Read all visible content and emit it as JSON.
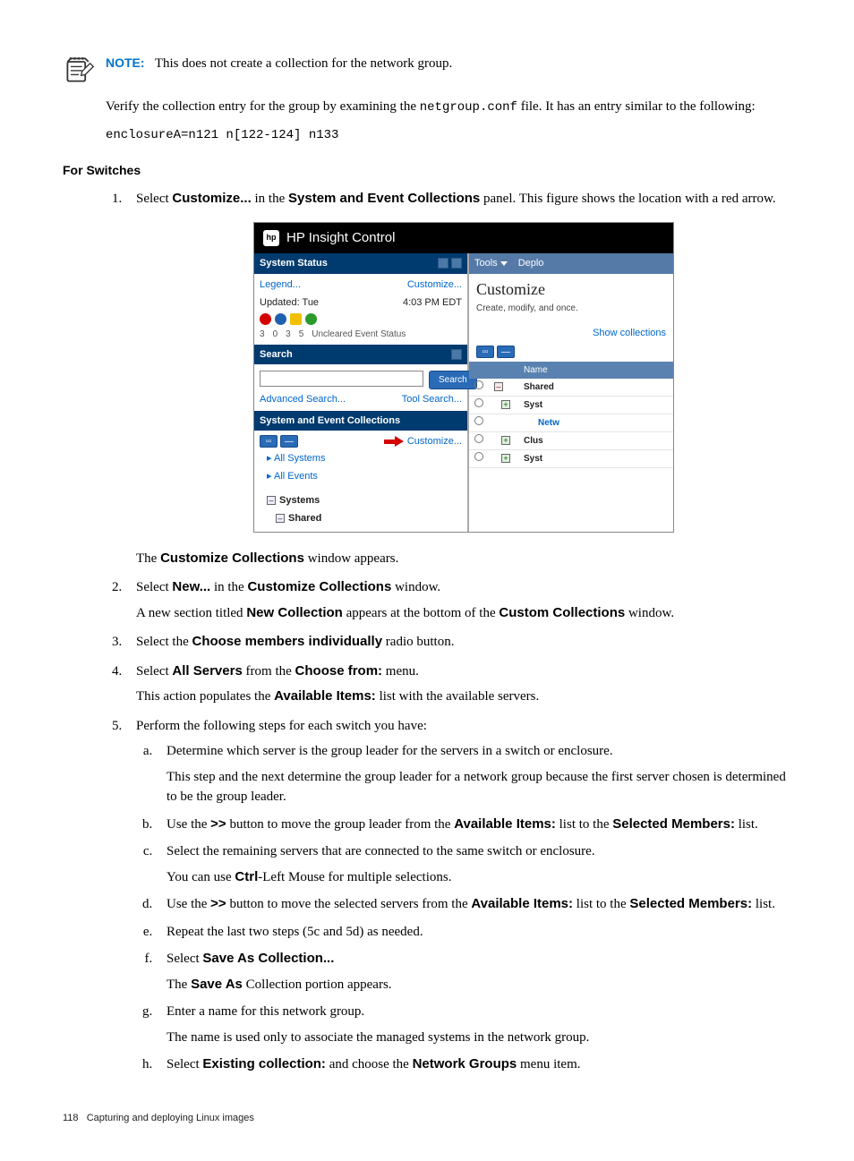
{
  "note": {
    "label": "NOTE:",
    "text": "This does not create a collection for the network group."
  },
  "verify_text_pre": "Verify the collection entry for the group by examining the ",
  "verify_file": "netgroup.conf",
  "verify_text_post": " file. It has an entry similar to the following:",
  "code_line": "enclosureA=n121 n[122-124] n133",
  "for_switches": "For Switches",
  "step1": {
    "pre": "Select ",
    "b1": "Customize...",
    "mid": " in the ",
    "b2": "System and Event Collections",
    "post": " panel. This figure shows the location with a red arrow."
  },
  "screenshot": {
    "title": "HP Insight Control",
    "left": {
      "sys_status": "System Status",
      "legend": "Legend...",
      "customize": "Customize...",
      "updated": "Updated: Tue",
      "time": "4:03 PM EDT",
      "uncleared": "Uncleared Event Status",
      "counts": [
        "3",
        "0",
        "3",
        "5"
      ],
      "search_hdr": "Search",
      "search_btn": "Search",
      "adv_search": "Advanced Search...",
      "tool_search": "Tool Search...",
      "sec_hdr": "System and Event Collections",
      "customize2": "Customize...",
      "all_systems": "All Systems",
      "all_events": "All Events",
      "systems": "Systems",
      "shared": "Shared"
    },
    "right": {
      "tools": "Tools",
      "deploy": "Deplo",
      "customize_title": "Customize",
      "customize_sub": "Create, modify, and once.",
      "show_collections": "Show collections",
      "name_hdr": "Name",
      "rows": [
        {
          "label": "Shared",
          "icon": "minus"
        },
        {
          "label": "Syst",
          "icon": "plus"
        },
        {
          "label": "Netw",
          "icon": "none"
        },
        {
          "label": "Clus",
          "icon": "plus"
        },
        {
          "label": "Syst",
          "icon": "plus"
        }
      ]
    }
  },
  "after_screenshot": {
    "pre": "The ",
    "b": "Customize Collections",
    "post": " window appears."
  },
  "step2": {
    "line1_pre": "Select ",
    "line1_b1": "New...",
    "line1_mid": " in the ",
    "line1_b2": "Customize Collections",
    "line1_post": " window.",
    "line2_pre": "A new section titled ",
    "line2_b1": "New Collection",
    "line2_mid": " appears at the bottom of the ",
    "line2_b2": "Custom Collections",
    "line2_post": " window."
  },
  "step3": {
    "pre": "Select the ",
    "b": "Choose members individually",
    "post": " radio button."
  },
  "step4": {
    "line1_pre": "Select ",
    "line1_b1": "All Servers",
    "line1_mid": " from the ",
    "line1_b2": "Choose from:",
    "line1_post": " menu.",
    "line2_pre": "This action populates the ",
    "line2_b": "Available Items:",
    "line2_post": " list with the available servers."
  },
  "step5": {
    "intro": "Perform the following steps for each switch you have:",
    "a": {
      "l1": "Determine which server is the group leader for the servers in a switch or enclosure.",
      "l2": "This step and the next determine the group leader for a network group because the first server chosen is determined to be the group leader."
    },
    "b": {
      "pre": "Use the ",
      "bb": ">>",
      "mid": " button to move the group leader from the ",
      "b2": "Available Items:",
      "mid2": " list to the ",
      "b3": "Selected Members:",
      "post": " list."
    },
    "c": {
      "l1": "Select the remaining servers that are connected to the same switch or enclosure.",
      "l2_pre": "You can use ",
      "l2_b": "Ctrl",
      "l2_post": "-Left Mouse for multiple selections."
    },
    "d": {
      "pre": "Use the ",
      "bb": ">>",
      "mid": " button to move the selected servers from the ",
      "b2": "Available Items:",
      "mid2": " list to the ",
      "b3": "Selected Members:",
      "post": " list."
    },
    "e": "Repeat the last two steps (5c and 5d) as needed.",
    "f": {
      "pre": "Select ",
      "b": "Save As Collection...",
      "l2_pre": "The ",
      "l2_b": "Save As",
      "l2_post": " Collection portion appears."
    },
    "g": {
      "l1": "Enter a name for this network group.",
      "l2": "The name is used only to associate the managed systems in the network group."
    },
    "h": {
      "pre": "Select ",
      "b1": "Existing collection:",
      "mid": " and choose the ",
      "b2": "Network Groups",
      "post": " menu item."
    }
  },
  "footer": {
    "page": "118",
    "title": "Capturing and deploying Linux images"
  }
}
